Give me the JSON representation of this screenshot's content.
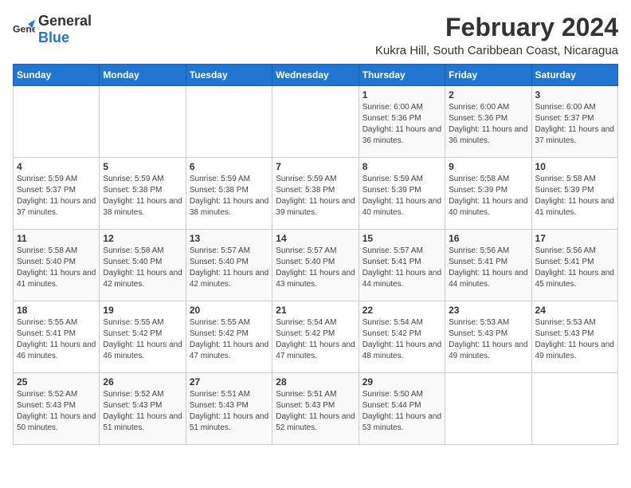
{
  "logo": {
    "general": "General",
    "blue": "Blue"
  },
  "title": "February 2024",
  "subtitle": "Kukra Hill, South Caribbean Coast, Nicaragua",
  "days_of_week": [
    "Sunday",
    "Monday",
    "Tuesday",
    "Wednesday",
    "Thursday",
    "Friday",
    "Saturday"
  ],
  "weeks": [
    [
      {
        "day": "",
        "info": ""
      },
      {
        "day": "",
        "info": ""
      },
      {
        "day": "",
        "info": ""
      },
      {
        "day": "",
        "info": ""
      },
      {
        "day": "1",
        "info": "Sunrise: 6:00 AM\nSunset: 5:36 PM\nDaylight: 11 hours\nand 36 minutes."
      },
      {
        "day": "2",
        "info": "Sunrise: 6:00 AM\nSunset: 5:36 PM\nDaylight: 11 hours\nand 36 minutes."
      },
      {
        "day": "3",
        "info": "Sunrise: 6:00 AM\nSunset: 5:37 PM\nDaylight: 11 hours\nand 37 minutes."
      }
    ],
    [
      {
        "day": "4",
        "info": "Sunrise: 5:59 AM\nSunset: 5:37 PM\nDaylight: 11 hours\nand 37 minutes."
      },
      {
        "day": "5",
        "info": "Sunrise: 5:59 AM\nSunset: 5:38 PM\nDaylight: 11 hours\nand 38 minutes."
      },
      {
        "day": "6",
        "info": "Sunrise: 5:59 AM\nSunset: 5:38 PM\nDaylight: 11 hours\nand 38 minutes."
      },
      {
        "day": "7",
        "info": "Sunrise: 5:59 AM\nSunset: 5:38 PM\nDaylight: 11 hours\nand 39 minutes."
      },
      {
        "day": "8",
        "info": "Sunrise: 5:59 AM\nSunset: 5:39 PM\nDaylight: 11 hours\nand 40 minutes."
      },
      {
        "day": "9",
        "info": "Sunrise: 5:58 AM\nSunset: 5:39 PM\nDaylight: 11 hours\nand 40 minutes."
      },
      {
        "day": "10",
        "info": "Sunrise: 5:58 AM\nSunset: 5:39 PM\nDaylight: 11 hours\nand 41 minutes."
      }
    ],
    [
      {
        "day": "11",
        "info": "Sunrise: 5:58 AM\nSunset: 5:40 PM\nDaylight: 11 hours\nand 41 minutes."
      },
      {
        "day": "12",
        "info": "Sunrise: 5:58 AM\nSunset: 5:40 PM\nDaylight: 11 hours\nand 42 minutes."
      },
      {
        "day": "13",
        "info": "Sunrise: 5:57 AM\nSunset: 5:40 PM\nDaylight: 11 hours\nand 42 minutes."
      },
      {
        "day": "14",
        "info": "Sunrise: 5:57 AM\nSunset: 5:40 PM\nDaylight: 11 hours\nand 43 minutes."
      },
      {
        "day": "15",
        "info": "Sunrise: 5:57 AM\nSunset: 5:41 PM\nDaylight: 11 hours\nand 44 minutes."
      },
      {
        "day": "16",
        "info": "Sunrise: 5:56 AM\nSunset: 5:41 PM\nDaylight: 11 hours\nand 44 minutes."
      },
      {
        "day": "17",
        "info": "Sunrise: 5:56 AM\nSunset: 5:41 PM\nDaylight: 11 hours\nand 45 minutes."
      }
    ],
    [
      {
        "day": "18",
        "info": "Sunrise: 5:55 AM\nSunset: 5:41 PM\nDaylight: 11 hours\nand 46 minutes."
      },
      {
        "day": "19",
        "info": "Sunrise: 5:55 AM\nSunset: 5:42 PM\nDaylight: 11 hours\nand 46 minutes."
      },
      {
        "day": "20",
        "info": "Sunrise: 5:55 AM\nSunset: 5:42 PM\nDaylight: 11 hours\nand 47 minutes."
      },
      {
        "day": "21",
        "info": "Sunrise: 5:54 AM\nSunset: 5:42 PM\nDaylight: 11 hours\nand 47 minutes."
      },
      {
        "day": "22",
        "info": "Sunrise: 5:54 AM\nSunset: 5:42 PM\nDaylight: 11 hours\nand 48 minutes."
      },
      {
        "day": "23",
        "info": "Sunrise: 5:53 AM\nSunset: 5:43 PM\nDaylight: 11 hours\nand 49 minutes."
      },
      {
        "day": "24",
        "info": "Sunrise: 5:53 AM\nSunset: 5:43 PM\nDaylight: 11 hours\nand 49 minutes."
      }
    ],
    [
      {
        "day": "25",
        "info": "Sunrise: 5:52 AM\nSunset: 5:43 PM\nDaylight: 11 hours\nand 50 minutes."
      },
      {
        "day": "26",
        "info": "Sunrise: 5:52 AM\nSunset: 5:43 PM\nDaylight: 11 hours\nand 51 minutes."
      },
      {
        "day": "27",
        "info": "Sunrise: 5:51 AM\nSunset: 5:43 PM\nDaylight: 11 hours\nand 51 minutes."
      },
      {
        "day": "28",
        "info": "Sunrise: 5:51 AM\nSunset: 5:43 PM\nDaylight: 11 hours\nand 52 minutes."
      },
      {
        "day": "29",
        "info": "Sunrise: 5:50 AM\nSunset: 5:44 PM\nDaylight: 11 hours\nand 53 minutes."
      },
      {
        "day": "",
        "info": ""
      },
      {
        "day": "",
        "info": ""
      }
    ]
  ]
}
